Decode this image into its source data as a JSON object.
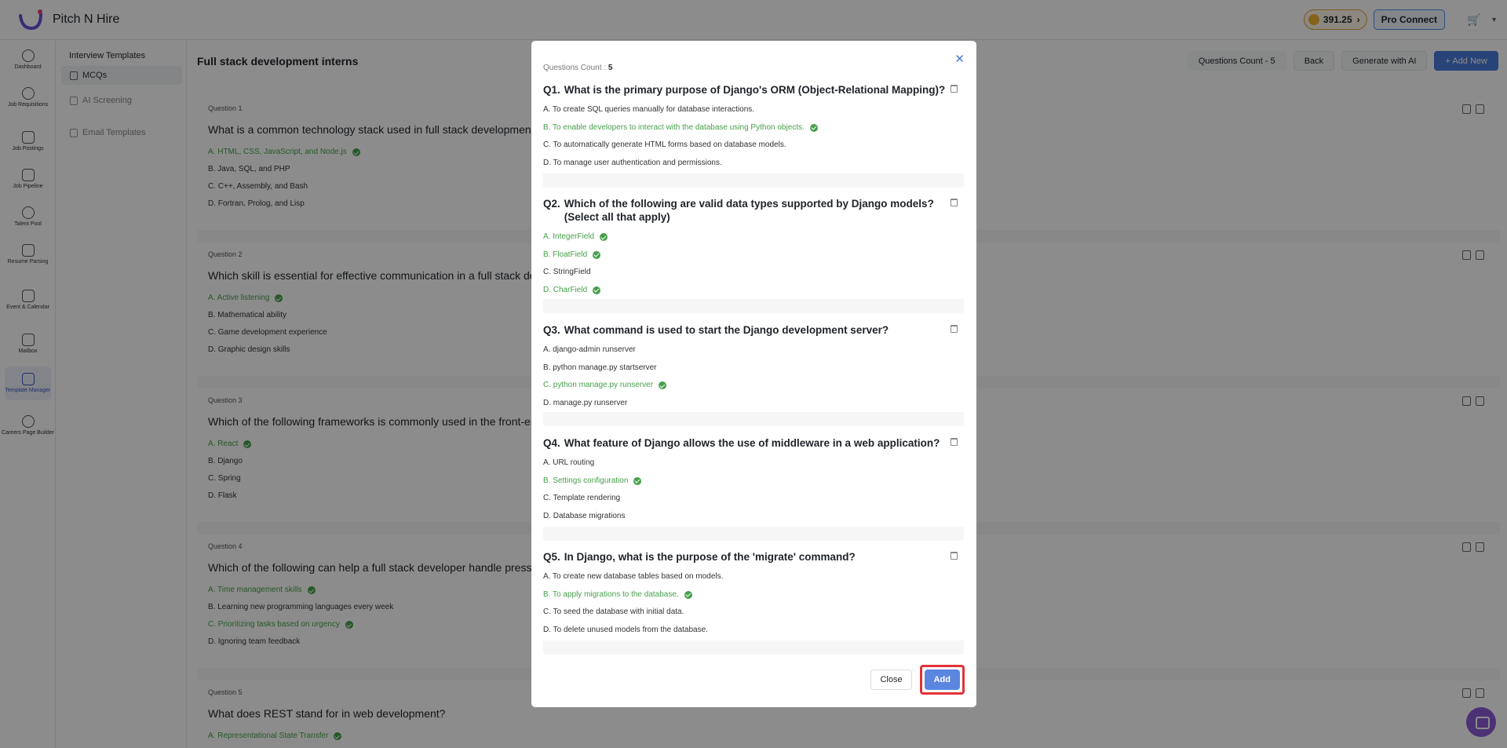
{
  "app": {
    "brand": "Pitch N Hire",
    "credits": "391.25",
    "pro_connect": "Pro Connect"
  },
  "sidebar": {
    "items": [
      {
        "label": "Dashboard",
        "icon": "dashboard-icon"
      },
      {
        "label": "Job Requisitions",
        "icon": "user-search-icon"
      },
      {
        "label": "Job Postings",
        "icon": "briefcase-icon"
      },
      {
        "label": "Job Pipeline",
        "icon": "document-icon"
      },
      {
        "label": "Talent Pool",
        "icon": "people-search-icon"
      },
      {
        "label": "Resume Parsing",
        "icon": "resume-icon"
      },
      {
        "label": "Event & Calendar",
        "icon": "calendar-icon"
      },
      {
        "label": "Mailbox",
        "icon": "mail-icon"
      },
      {
        "label": "Template Manager",
        "icon": "layers-icon"
      },
      {
        "label": "Careers Page Builder",
        "icon": "globe-icon"
      }
    ]
  },
  "subnav": {
    "title": "Interview Templates",
    "items": [
      {
        "label": "MCQs"
      },
      {
        "label": "AI Screening"
      },
      {
        "label": "Email Templates"
      }
    ]
  },
  "main": {
    "title": "Full stack development interns",
    "buttons": {
      "count": "Questions Count - 5",
      "back": "Back",
      "generate": "Generate with AI",
      "add_new": "+ Add New"
    },
    "questions": [
      {
        "label": "Question 1",
        "text": "What is a common technology stack used in full stack development?",
        "options": [
          {
            "text": "A. HTML, CSS, JavaScript, and Node.js",
            "correct": true
          },
          {
            "text": "B. Java, SQL, and PHP",
            "correct": false
          },
          {
            "text": "C. C++, Assembly, and Bash",
            "correct": false
          },
          {
            "text": "D. Fortran, Prolog, and Lisp",
            "correct": false
          }
        ]
      },
      {
        "label": "Question 2",
        "text": "Which skill is essential for effective communication in a full stack de",
        "options": [
          {
            "text": "A. Active listening",
            "correct": true
          },
          {
            "text": "B. Mathematical ability",
            "correct": false
          },
          {
            "text": "C. Game development experience",
            "correct": false
          },
          {
            "text": "D. Graphic design skills",
            "correct": false
          }
        ]
      },
      {
        "label": "Question 3",
        "text": "Which of the following frameworks is commonly used in the front-en",
        "options": [
          {
            "text": "A. React",
            "correct": true
          },
          {
            "text": "B. Django",
            "correct": false
          },
          {
            "text": "C. Spring",
            "correct": false
          },
          {
            "text": "D. Flask",
            "correct": false
          }
        ]
      },
      {
        "label": "Question 4",
        "text": "Which of the following can help a full stack developer handle pressu",
        "options": [
          {
            "text": "A. Time management skills",
            "correct": true
          },
          {
            "text": "B. Learning new programming languages every week",
            "correct": false
          },
          {
            "text": "C. Prioritizing tasks based on urgency",
            "correct": true
          },
          {
            "text": "D. Ignoring team feedback",
            "correct": false
          }
        ]
      },
      {
        "label": "Question 5",
        "text": "What does REST stand for in web development?",
        "options": [
          {
            "text": "A. Representational State Transfer",
            "correct": true
          }
        ]
      }
    ]
  },
  "modal": {
    "count_label": "Questions Count :",
    "count_value": "5",
    "close_label": "Close",
    "add_label": "Add",
    "questions": [
      {
        "num": "Q1.",
        "text": "What is the primary purpose of Django's ORM (Object-Relational Mapping)?",
        "options": [
          {
            "text": "A. To create SQL queries manually for database interactions.",
            "correct": false
          },
          {
            "text": "B. To enable developers to interact with the database using Python objects.",
            "correct": true
          },
          {
            "text": "C. To automatically generate HTML forms based on database models.",
            "correct": false
          },
          {
            "text": "D. To manage user authentication and permissions.",
            "correct": false
          }
        ]
      },
      {
        "num": "Q2.",
        "text": "Which of the following are valid data types supported by Django models? (Select all that apply)",
        "options": [
          {
            "text": "A. IntegerField",
            "correct": true
          },
          {
            "text": "B. FloatField",
            "correct": true
          },
          {
            "text": "C. StringField",
            "correct": false
          },
          {
            "text": "D. CharField",
            "correct": true
          }
        ]
      },
      {
        "num": "Q3.",
        "text": "What command is used to start the Django development server?",
        "options": [
          {
            "text": "A. django-admin runserver",
            "correct": false
          },
          {
            "text": "B. python manage.py startserver",
            "correct": false
          },
          {
            "text": "C. python manage.py runserver",
            "correct": true
          },
          {
            "text": "D. manage.py runserver",
            "correct": false
          }
        ]
      },
      {
        "num": "Q4.",
        "text": "What feature of Django allows the use of middleware in a web application?",
        "options": [
          {
            "text": "A. URL routing",
            "correct": false
          },
          {
            "text": "B. Settings configuration",
            "correct": true
          },
          {
            "text": "C. Template rendering",
            "correct": false
          },
          {
            "text": "D. Database migrations",
            "correct": false
          }
        ]
      },
      {
        "num": "Q5.",
        "text": "In Django, what is the purpose of the 'migrate' command?",
        "options": [
          {
            "text": "A. To create new database tables based on models.",
            "correct": false
          },
          {
            "text": "B. To apply migrations to the database.",
            "correct": true
          },
          {
            "text": "C. To seed the database with initial data.",
            "correct": false
          },
          {
            "text": "D. To delete unused models from the database.",
            "correct": false
          }
        ]
      }
    ]
  }
}
